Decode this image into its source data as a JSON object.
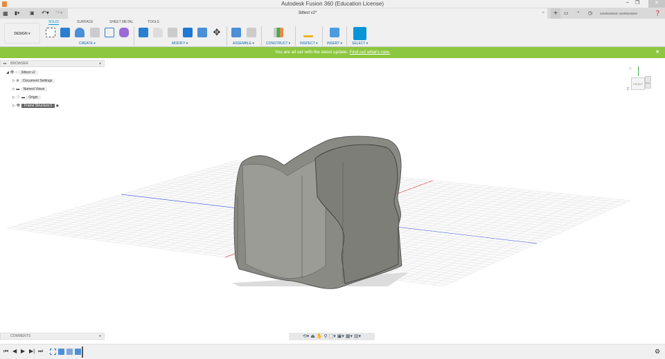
{
  "app": {
    "title": "Autodesk Fusion 360 (Education License)"
  },
  "tabs": {
    "document": "3dtest v2*",
    "user": "sarahasisiam sarahasisiam"
  },
  "toolbar": {
    "workspace": "DESIGN ▾",
    "workspace_tabs": [
      "SOLID",
      "SURFACE",
      "SHEET METAL",
      "TOOLS"
    ],
    "active_tab": "SOLID",
    "groups": [
      "CREATE ▾",
      "MODIFY ▾",
      "ASSEMBLE ▾",
      "CONSTRUCT ▾",
      "INSPECT ▾",
      "INSERT ▾",
      "SELECT ▾"
    ]
  },
  "banner": {
    "text": "You are all set with the latest update.",
    "link": "Find out what's new.",
    "color": "#8dc63f"
  },
  "browser": {
    "title": "BROWSER",
    "root": "3dtest v2",
    "items": [
      "Document Settings",
      "Named Views",
      "Origin",
      "Frame Structure:1"
    ]
  },
  "viewcube": {
    "front": "FRONT",
    "right": "RIGHT"
  },
  "comments": {
    "title": "COMMENTS"
  },
  "accent": "#0696d7"
}
